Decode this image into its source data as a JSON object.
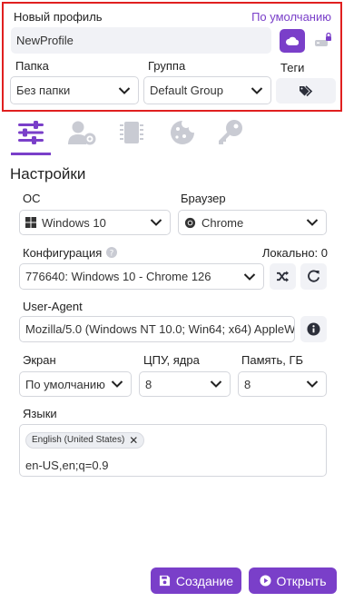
{
  "profile": {
    "name_label": "Новый профиль",
    "default_link": "По умолчанию",
    "name_value": "NewProfile",
    "folder_label": "Папка",
    "folder_value": "Без папки",
    "group_label": "Группа",
    "group_value": "Default Group",
    "tags_label": "Теги"
  },
  "tabs": [
    {
      "name": "settings-sliders-icon",
      "active": true
    },
    {
      "name": "user-settings-icon",
      "active": false
    },
    {
      "name": "chip-icon",
      "active": false
    },
    {
      "name": "cookie-icon",
      "active": false
    },
    {
      "name": "key-icon",
      "active": false
    }
  ],
  "settings": {
    "title": "Настройки",
    "os_label": "ОС",
    "os_value": "Windows 10",
    "browser_label": "Браузер",
    "browser_value": "Chrome",
    "config_label": "Конфигурация",
    "config_local": "Локально: 0",
    "config_value": "776640: Windows 10 - Chrome 126",
    "ua_label": "User-Agent",
    "ua_value": "Mozilla/5.0 (Windows NT 10.0; Win64; x64) AppleWe",
    "screen_label": "Экран",
    "screen_value": "По умолчанию",
    "cpu_label": "ЦПУ, ядра",
    "cpu_value": "8",
    "mem_label": "Память, ГБ",
    "mem_value": "8",
    "langs_label": "Языки",
    "lang_tag": "English (United States)",
    "lang_string": "en-US,en;q=0.9"
  },
  "actions": {
    "create_label": "Создание",
    "open_label": "Открыть"
  },
  "colors": {
    "accent": "#7a3fc9",
    "highlight": "#e02020",
    "field_bg": "#f1f2f6"
  }
}
